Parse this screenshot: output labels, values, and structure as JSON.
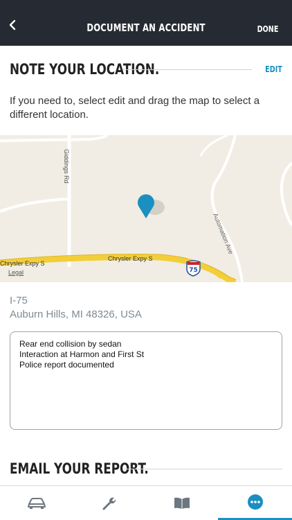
{
  "header": {
    "title": "DOCUMENT AN ACCIDENT",
    "done_label": "DONE"
  },
  "location_section": {
    "heading": "NOTE YOUR LOCATION.",
    "edit_label": "EDIT",
    "instructions": "If you need to, select edit and drag the map to select a different location."
  },
  "map": {
    "road_labels": [
      "Giddings Rd",
      "Chrysler Expy S",
      "Chrysler Expy S",
      "Automation Ave"
    ],
    "highway_shield": "75",
    "legal_label": "Legal"
  },
  "address": {
    "line1": "I-75",
    "line2": "Auburn Hills, MI 48326, USA"
  },
  "notes": {
    "value": "Rear end collision by sedan\nInteraction at Harmon and First St\nPolice report documented"
  },
  "email_section": {
    "heading": "EMAIL YOUR REPORT."
  },
  "tabbar": {
    "tabs": [
      {
        "icon": "car-icon"
      },
      {
        "icon": "wrench-icon"
      },
      {
        "icon": "book-icon"
      },
      {
        "icon": "more-icon",
        "active": true
      }
    ]
  },
  "colors": {
    "header_bg": "#262a33",
    "accent": "#1a8fc0",
    "map_bg": "#f1ede4",
    "highway": "#f2cf3a"
  }
}
